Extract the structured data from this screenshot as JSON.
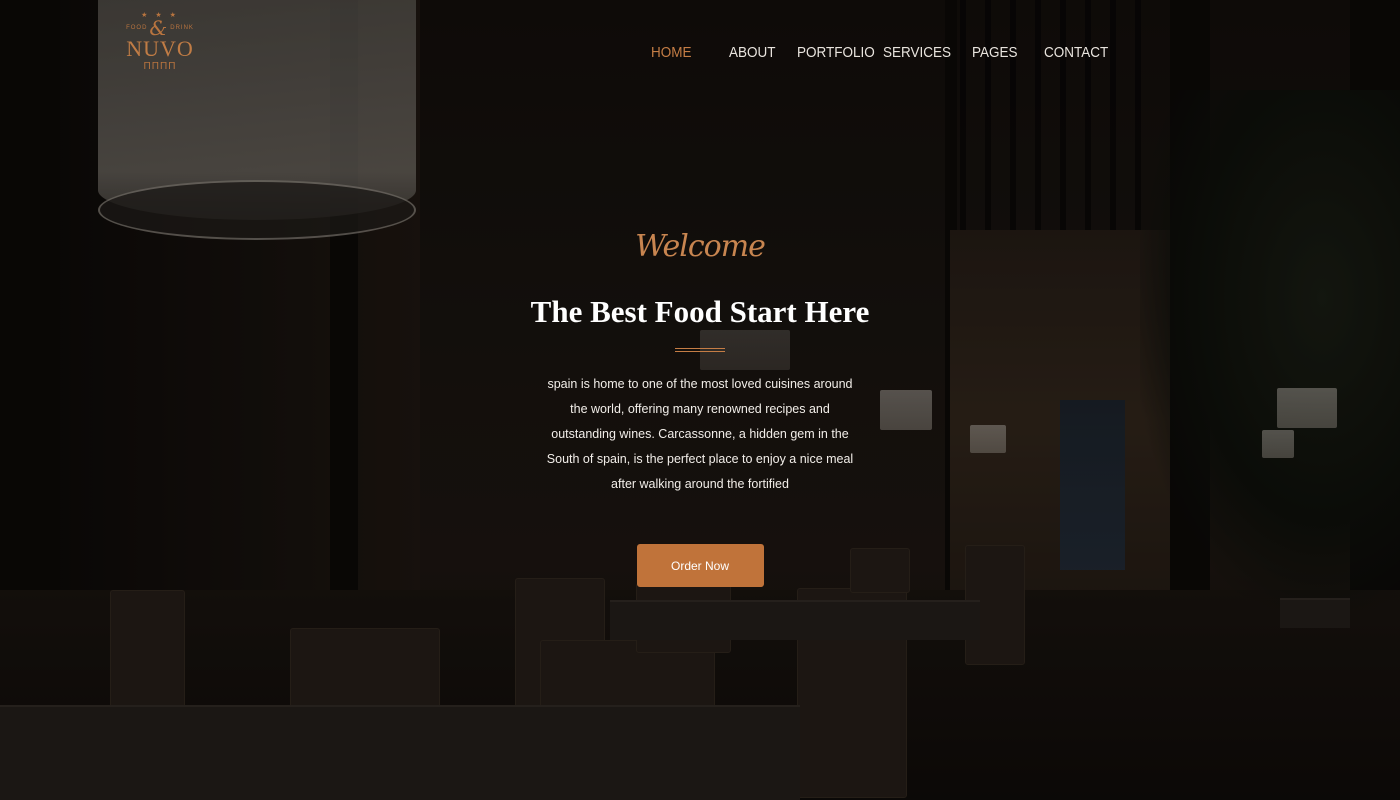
{
  "logo": {
    "stars": "★ ★ ★",
    "tag_left": "FOOD",
    "ampersand": "&",
    "tag_right": "DRINK",
    "brand": "NUVO",
    "fork_glyph": "ΠΠΠΠ"
  },
  "nav": {
    "items": [
      {
        "label": "HOME",
        "active": true
      },
      {
        "label": "ABOUT",
        "active": false
      },
      {
        "label": "PORTFOLIO",
        "active": false
      },
      {
        "label": "SERVICES",
        "active": false
      },
      {
        "label": "PAGES",
        "active": false
      },
      {
        "label": "CONTACT",
        "active": false
      }
    ]
  },
  "hero": {
    "welcome": "Welcome",
    "headline": "The Best Food Start Here",
    "description": "spain is home to one of the most loved cuisines around the world, offering many renowned recipes and outstanding wines. Carcassonne, a hidden gem in the South of spain, is the perfect place to enjoy a nice meal after walking around the fortified",
    "cta_label": "Order Now"
  },
  "colors": {
    "accent": "#c0733a",
    "active_nav": "#c57d45",
    "text": "#ffffff"
  }
}
